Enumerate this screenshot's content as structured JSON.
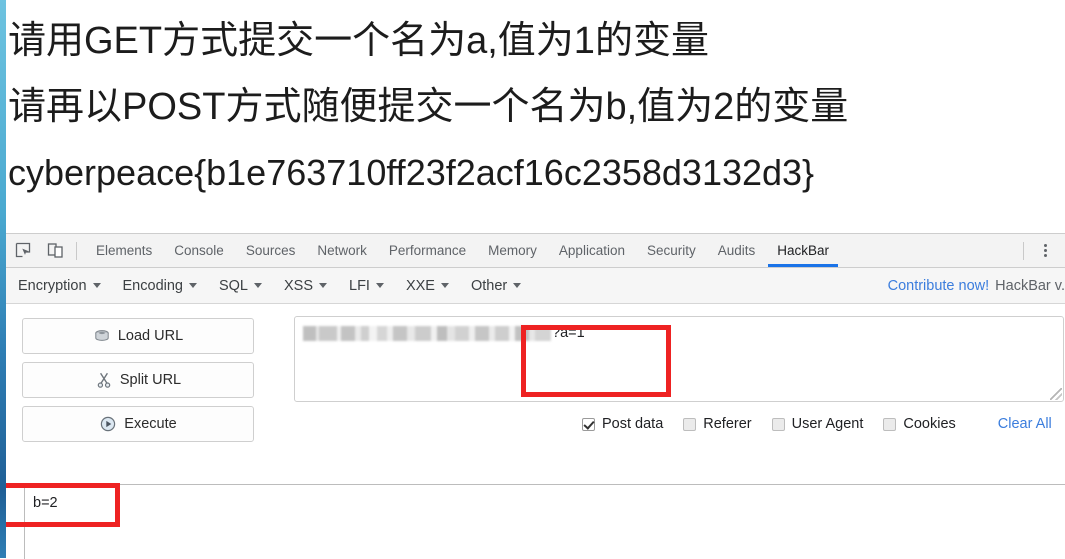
{
  "page": {
    "lines": [
      "请用GET方式提交一个名为a,值为1的变量",
      "请再以POST方式随便提交一个名为b,值为2的变量",
      "cyberpeace{b1e763710ff23f2acf16c2358d3132d3}"
    ]
  },
  "devtools": {
    "icons": {
      "inspect": "inspect-element-icon",
      "device": "device-toolbar-icon",
      "more": "more-options-icon"
    },
    "tabs": [
      {
        "label": "Elements",
        "active": false
      },
      {
        "label": "Console",
        "active": false
      },
      {
        "label": "Sources",
        "active": false
      },
      {
        "label": "Network",
        "active": false
      },
      {
        "label": "Performance",
        "active": false
      },
      {
        "label": "Memory",
        "active": false
      },
      {
        "label": "Application",
        "active": false
      },
      {
        "label": "Security",
        "active": false
      },
      {
        "label": "Audits",
        "active": false
      },
      {
        "label": "HackBar",
        "active": true
      }
    ],
    "active_tab": "HackBar",
    "accent_color": "#1a73e8"
  },
  "hackbar": {
    "menus": [
      "Encryption",
      "Encoding",
      "SQL",
      "XSS",
      "LFI",
      "XXE",
      "Other"
    ],
    "contribute_label": "Contribute now!",
    "version_label": "HackBar v.",
    "link_color": "#3b7ddd",
    "buttons": [
      {
        "label": "Load URL",
        "icon": "disk-icon"
      },
      {
        "label": "Split URL",
        "icon": "scissors-icon"
      },
      {
        "label": "Execute",
        "icon": "play-icon"
      }
    ],
    "url_field": {
      "blurred_prefix": "",
      "visible_query": "?a=1"
    },
    "options": [
      {
        "label": "Post data",
        "checked": true
      },
      {
        "label": "Referer",
        "checked": false
      },
      {
        "label": "User Agent",
        "checked": false
      },
      {
        "label": "Cookies",
        "checked": false
      }
    ],
    "clear_all_label": "Clear All",
    "post_data_value": "b=2"
  },
  "annotations": {
    "color": "#ee2222",
    "boxes": [
      {
        "name": "get-param-highlight",
        "target": "?a=1"
      },
      {
        "name": "post-data-highlight",
        "target": "b=2"
      }
    ]
  }
}
